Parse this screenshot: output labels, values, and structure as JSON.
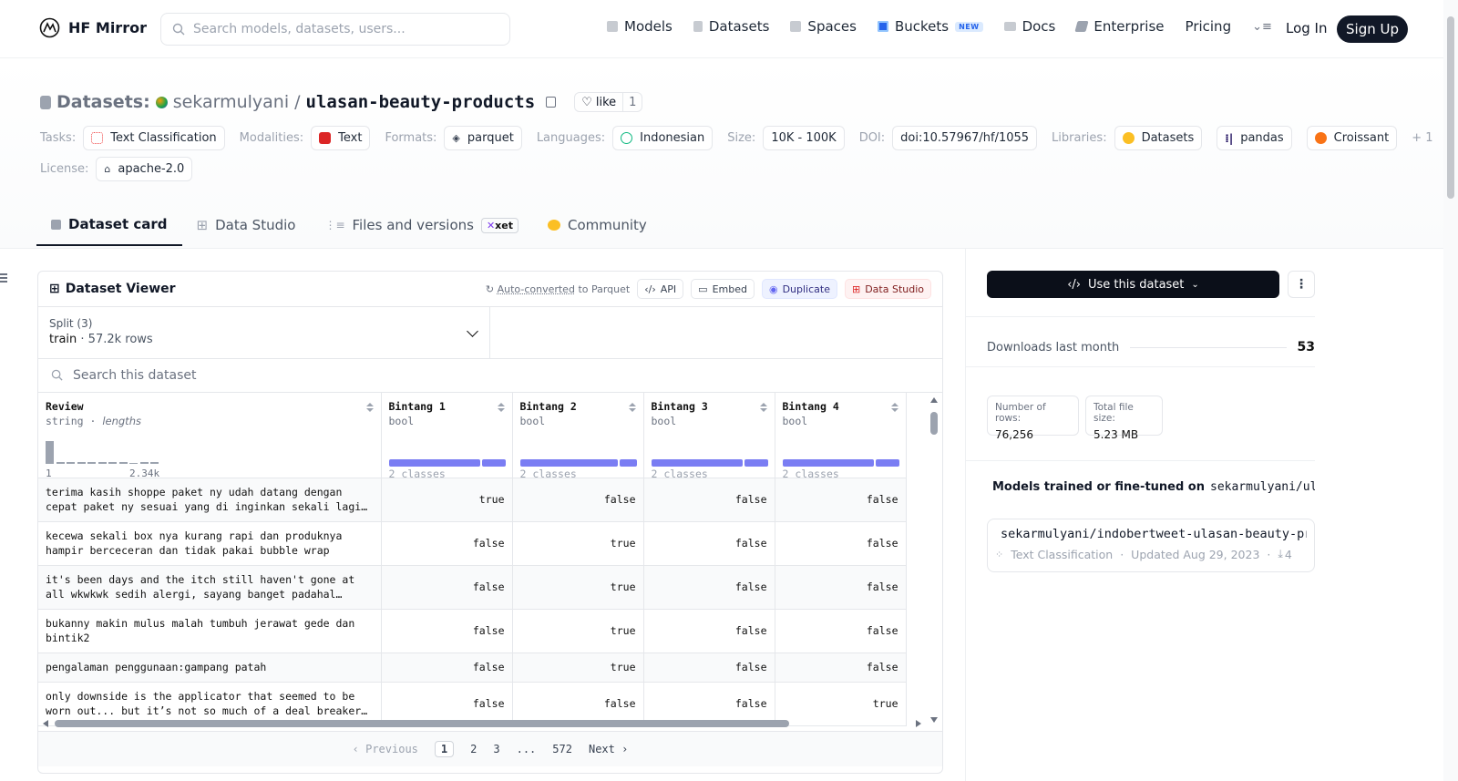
{
  "nav": {
    "brand": "HF Mirror",
    "search_placeholder": "Search models, datasets, users...",
    "links": [
      {
        "label": "Models",
        "icon": "cube-icon",
        "color": "#9ca3af"
      },
      {
        "label": "Datasets",
        "icon": "database-icon",
        "color": "#9ca3af"
      },
      {
        "label": "Spaces",
        "icon": "grid-icon",
        "color": "#9ca3af"
      },
      {
        "label": "Buckets",
        "icon": "bucket-icon",
        "color": "#2563eb"
      },
      {
        "label": "Docs",
        "icon": "book-icon",
        "color": "#9ca3af"
      },
      {
        "label": "Enterprise",
        "icon": "enterprise-icon",
        "color": "#6b7280"
      },
      {
        "label": "Pricing"
      }
    ],
    "new_badge": "NEW",
    "login": "Log In",
    "signup": "Sign Up"
  },
  "header": {
    "section": "Datasets:",
    "owner": "sekarmulyani",
    "separator": "/",
    "name": "ulasan-beauty-products",
    "like_label": "like",
    "like_count": "1"
  },
  "tags": {
    "tasks_label": "Tasks:",
    "task": "Text Classification",
    "modalities_label": "Modalities:",
    "modality": "Text",
    "formats_label": "Formats:",
    "format": "parquet",
    "languages_label": "Languages:",
    "language": "Indonesian",
    "size_label": "Size:",
    "size": "10K - 100K",
    "doi_label": "DOI:",
    "doi": "doi:10.57967/hf/1055",
    "libraries_label": "Libraries:",
    "libraries": [
      "Datasets",
      "pandas",
      "Croissant"
    ],
    "more_libraries": "+ 1",
    "license_label": "License:",
    "license": "apache-2.0"
  },
  "tabs": [
    {
      "label": "Dataset card",
      "active": true
    },
    {
      "label": "Data Studio"
    },
    {
      "label": "Files and versions"
    },
    {
      "label": "Community"
    }
  ],
  "xet_badge": "xet",
  "viewer": {
    "title": "Dataset Viewer",
    "auto_converted": "Auto-converted",
    "to_parquet": "to Parquet",
    "api": "API",
    "embed": "Embed",
    "duplicate": "Duplicate",
    "data_studio": "Data Studio",
    "split_label": "Split (3)",
    "split_value": "train",
    "split_rows": "57.2k rows",
    "search_placeholder": "Search this dataset",
    "columns": [
      {
        "name": "Review",
        "type": "string",
        "stat": "lengths",
        "min": "1",
        "max": "2.34k"
      },
      {
        "name": "Bintang 1",
        "type": "bool",
        "classes": "2 classes"
      },
      {
        "name": "Bintang 2",
        "type": "bool",
        "classes": "2 classes"
      },
      {
        "name": "Bintang 3",
        "type": "bool",
        "classes": "2 classes"
      },
      {
        "name": "Bintang 4",
        "type": "bool",
        "classes": "2 classes"
      }
    ],
    "length_histogram": [
      1.0,
      0.1,
      0.1,
      0.1,
      0.1,
      0.1,
      0.1,
      0.1,
      0.05,
      0.1,
      0.1
    ],
    "bool_true_fraction": [
      0.8,
      0.85,
      0.8,
      0.8
    ],
    "rows": [
      {
        "review": "terima kasih shoppe paket ny udah datang dengan cepat paket ny sesuai yang di inginkan sekali lagi terima kasih",
        "b1": "true",
        "b2": "false",
        "b3": "false",
        "b4": "false"
      },
      {
        "review": "kecewa sekali box nya kurang rapi dan produknya hampir berceceran dan tidak pakai bubble wrap",
        "b1": "false",
        "b2": "true",
        "b3": "false",
        "b4": "false"
      },
      {
        "review": "it's been days and the itch still haven't gone at all wkwkwk sedih alergi, sayang banget padahal belinya mahal",
        "b1": "false",
        "b2": "true",
        "b3": "false",
        "b4": "false"
      },
      {
        "review": "bukanny makin mulus malah tumbuh jerawat gede dan bintik2",
        "b1": "false",
        "b2": "true",
        "b3": "false",
        "b4": "false"
      },
      {
        "review": "pengalaman penggunaan:gampang patah",
        "b1": "false",
        "b2": "true",
        "b3": "false",
        "b4": "false"
      },
      {
        "review": "only downside is the applicator that seemed to be worn out... but it’s not so much of a deal breaker for me",
        "b1": "false",
        "b2": "false",
        "b3": "false",
        "b4": "true"
      }
    ],
    "pager": {
      "prev": "Previous",
      "pages": [
        "1",
        "2",
        "3",
        "...",
        "572"
      ],
      "next": "Next"
    }
  },
  "side": {
    "use_btn": "Use this dataset",
    "downloads_label": "Downloads last month",
    "downloads": "53",
    "rows_label": "Number of rows:",
    "rows": "76,256",
    "size_label": "Total file size:",
    "size": "5.23 MB",
    "models_heading": "Models trained or fine-tuned on",
    "models_heading_repo": "sekarmulyani/ulasan-beauty-products",
    "model_name": "sekarmulyani/indobertweet-ulasan-beauty-products",
    "model_task": "Text Classification",
    "model_updated": "Updated Aug 29, 2023",
    "model_downloads": "4"
  }
}
